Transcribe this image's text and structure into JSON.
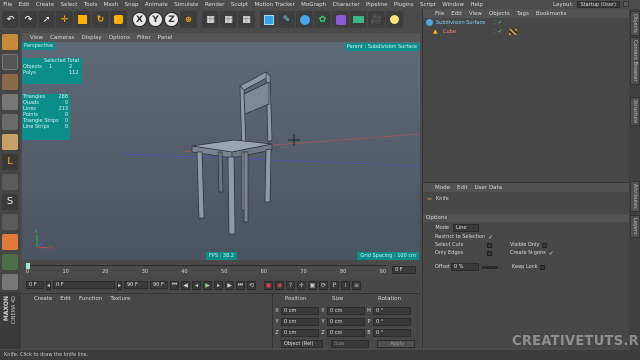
{
  "menu": [
    "File",
    "Edit",
    "Create",
    "Select",
    "Tools",
    "Mesh",
    "Snap",
    "Animate",
    "Simulate",
    "Render",
    "Sculpt",
    "Motion Tracker",
    "MoGraph",
    "Character",
    "Pipeline",
    "Plugins",
    "Script",
    "Window",
    "Help"
  ],
  "layout": {
    "label": "Layout:",
    "value": "Startup (User)"
  },
  "toolbar": {
    "x": "X",
    "y": "Y",
    "z": "Z"
  },
  "viewport": {
    "menu": [
      "View",
      "Cameras",
      "Display",
      "Options",
      "Filter",
      "Panel"
    ],
    "name": "Perspective",
    "parent_label": "Parent : Subdivision Surface",
    "selected_total": "Selected Total",
    "objects": {
      "label": "Objects",
      "selected": "1",
      "total": "2"
    },
    "polys": {
      "label": "Polys",
      "value": "112"
    },
    "stats": [
      {
        "label": "Triangles",
        "value": "288"
      },
      {
        "label": "Quads",
        "value": "0"
      },
      {
        "label": "Lines",
        "value": "213"
      },
      {
        "label": "Points",
        "value": "0"
      },
      {
        "label": "Triangle Strips",
        "value": "0"
      },
      {
        "label": "Line Strips",
        "value": "0"
      }
    ],
    "fps": "FPS : 38.2",
    "grid_spacing": "Grid Spacing : 100 cm",
    "axis": {
      "y": "Y",
      "x": "X",
      "z": "Z"
    }
  },
  "timeline": {
    "ticks": [
      "0",
      "10",
      "20",
      "30",
      "40",
      "50",
      "60",
      "70",
      "80",
      "90"
    ],
    "current_frame": "0 F",
    "start": "0 F",
    "min_field": "0 F",
    "max_field": "90 F",
    "end": "90 F"
  },
  "material": {
    "menu": [
      "Create",
      "Edit",
      "Function",
      "Texture"
    ],
    "logo_lines": [
      "MAXON",
      "CINEMA 4D"
    ]
  },
  "coords": {
    "headers": [
      "Position",
      "Size",
      "Rotation"
    ],
    "rows": [
      {
        "axis": "X",
        "pos": "0 cm",
        "size_axis": "X",
        "size": "0 cm",
        "rot_axis": "H",
        "rot": "0 °"
      },
      {
        "axis": "Y",
        "pos": "0 cm",
        "size_axis": "Y",
        "size": "0 cm",
        "rot_axis": "P",
        "rot": "0 °"
      },
      {
        "axis": "Z",
        "pos": "0 cm",
        "size_axis": "Z",
        "size": "0 cm",
        "rot_axis": "B",
        "rot": "0 °"
      }
    ],
    "mode": "Object (Rel)",
    "size_mode": "Size",
    "apply": "Apply"
  },
  "objects": {
    "menu": [
      "File",
      "Edit",
      "View",
      "Objects",
      "Tags",
      "Bookmarks"
    ],
    "items": [
      {
        "name": "Subdivision Surface",
        "color": "#7fd0ff"
      },
      {
        "name": "Cube",
        "color": "#ff8a7a"
      }
    ]
  },
  "attributes": {
    "menu": [
      "Mode",
      "Edit",
      "User Data"
    ],
    "tool": "Knife",
    "options_title": "Options",
    "mode_label": "Mode",
    "mode_value": "Line",
    "restrict": "Restrict to Selection",
    "select_cuts": "Select Cuts",
    "visible_only": "Visible Only",
    "only_edges": "Only Edges",
    "create_ngons": "Create N-gons",
    "offset_label": "Offset",
    "offset_value": "0 %",
    "keep_lock": "Keep Lock"
  },
  "right_tabs": [
    "Objects",
    "Content Browser",
    "Structure",
    "Attributes",
    "Layers"
  ],
  "status": "Knife: Click to draw the knife line.",
  "watermark": "CREATIVETUTS.RU"
}
